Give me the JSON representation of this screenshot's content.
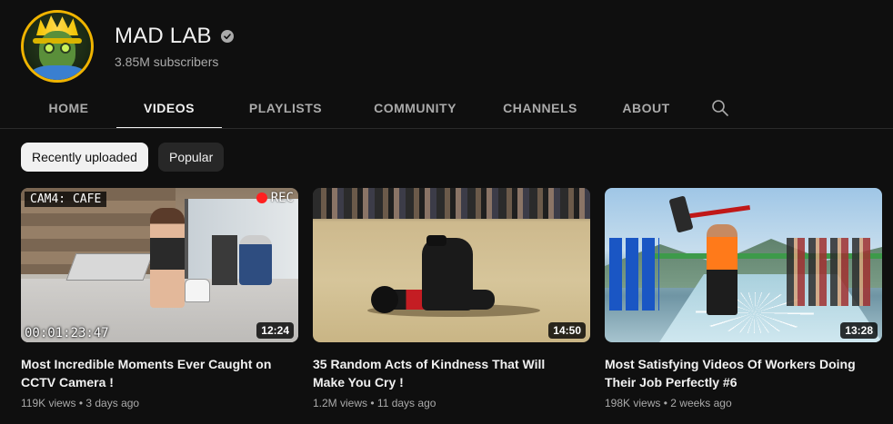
{
  "channel": {
    "title": "MAD LAB",
    "subscribers": "3.85M subscribers",
    "verified": true
  },
  "tabs": [
    {
      "label": "HOME",
      "active": false
    },
    {
      "label": "VIDEOS",
      "active": true
    },
    {
      "label": "PLAYLISTS",
      "active": false
    },
    {
      "label": "COMMUNITY",
      "active": false
    },
    {
      "label": "CHANNELS",
      "active": false
    },
    {
      "label": "ABOUT",
      "active": false
    }
  ],
  "chips": [
    {
      "label": "Recently uploaded",
      "active": true
    },
    {
      "label": "Popular",
      "active": false
    }
  ],
  "videos": [
    {
      "title": "Most Incredible Moments Ever Caught on CCTV Camera !",
      "views": "119K views",
      "age": "3 days ago",
      "duration": "12:24",
      "overlay": {
        "cam": "CAM4: CAFE",
        "rec": "REC",
        "timestamp": "00:01:23:47"
      }
    },
    {
      "title": "35 Random Acts of Kindness That Will Make You Cry !",
      "views": "1.2M views",
      "age": "11 days ago",
      "duration": "14:50"
    },
    {
      "title": "Most Satisfying Videos Of Workers Doing Their Job Perfectly #6",
      "views": "198K views",
      "age": "2 weeks ago",
      "duration": "13:28"
    }
  ],
  "meta_separator": "•",
  "colors": {
    "background": "#0f0f0f",
    "text_primary": "#f1f1f1",
    "text_secondary": "#aaaaaa",
    "chip_bg": "#272727"
  }
}
